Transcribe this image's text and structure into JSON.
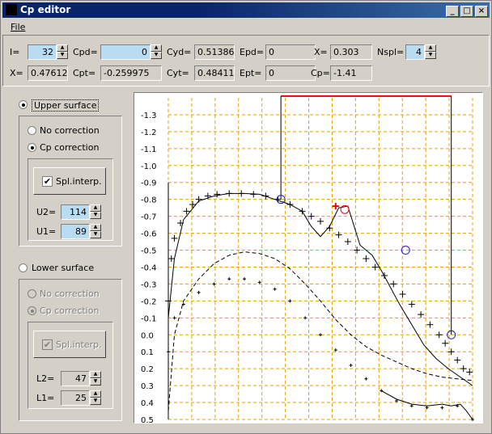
{
  "window": {
    "title": "Cp editor"
  },
  "menu": {
    "file": "File"
  },
  "fields": {
    "i_label": "I=",
    "i_value": "32",
    "cpd_label": "Cpd=",
    "cpd_value": "0",
    "cyd_label": "Cyd=",
    "cyd_value": "0.513863",
    "epd_label": "Epd=",
    "epd_value": "0",
    "x_label": "X=",
    "x_value": "0.303",
    "nspl_label": "Nspl=",
    "nspl_value": "4",
    "x2_label": "X=",
    "x2_value": "0.476129",
    "cpt_label": "Cpt=",
    "cpt_value": "-0.259975",
    "cyt_label": "Cyt=",
    "cyt_value": "0.484114",
    "ept_label": "Ept=",
    "ept_value": "0",
    "cp_label": "Cp=",
    "cp_value": "-1.41"
  },
  "upper": {
    "label": "Upper surface",
    "no_correction": "No correction",
    "cp_correction": "Cp correction",
    "spl_interp": "Spl.interp.",
    "u2_label": "U2=",
    "u2_value": "114",
    "u1_label": "U1=",
    "u1_value": "89"
  },
  "lower": {
    "label": "Lower surface",
    "no_correction": "No correction",
    "cp_correction": "Cp correction",
    "spl_interp": "Spl.interp.",
    "l2_label": "L2=",
    "l2_value": "47",
    "l1_label": "L1=",
    "l1_value": "25"
  },
  "chart_data": {
    "type": "line",
    "y_ticks": [
      "-1.3",
      "-1.2",
      "-1.1",
      "-1.0",
      "-0.9",
      "-0.8",
      "-0.7",
      "-0.6",
      "-0.5",
      "-0.4",
      "-0.3",
      "-0.2",
      "-0.1",
      "0.0",
      "0.1",
      "0.2",
      "0.3",
      "0.4",
      "0.5"
    ],
    "ylim": [
      -1.4,
      0.5
    ],
    "xlim": [
      0,
      1
    ],
    "inverted_y": true,
    "grid": true,
    "series": [
      {
        "style": "plus",
        "color": "#000000",
        "x": [
          0.0,
          0.01,
          0.02,
          0.04,
          0.06,
          0.08,
          0.1,
          0.13,
          0.16,
          0.2,
          0.24,
          0.28,
          0.32,
          0.36,
          0.4,
          0.44,
          0.47,
          0.5,
          0.53,
          0.56,
          0.59,
          0.62,
          0.65,
          0.68,
          0.71,
          0.74,
          0.77,
          0.8,
          0.83,
          0.86,
          0.89,
          0.91,
          0.93,
          0.95,
          0.97,
          0.99
        ],
        "y": [
          -0.2,
          -0.45,
          -0.57,
          -0.66,
          -0.73,
          -0.77,
          -0.8,
          -0.82,
          -0.83,
          -0.835,
          -0.835,
          -0.83,
          -0.82,
          -0.8,
          -0.77,
          -0.73,
          -0.7,
          -0.67,
          -0.63,
          -0.59,
          -0.55,
          -0.5,
          -0.45,
          -0.4,
          -0.35,
          -0.3,
          -0.24,
          -0.18,
          -0.12,
          -0.06,
          0.0,
          0.05,
          0.1,
          0.15,
          0.2,
          0.22
        ]
      },
      {
        "style": "solid",
        "color": "#000000",
        "x": [
          0.0,
          0.02,
          0.05,
          0.1,
          0.15,
          0.2,
          0.25,
          0.3,
          0.35,
          0.4,
          0.44,
          0.47,
          0.5,
          0.53,
          0.56,
          0.59,
          0.63,
          0.67,
          0.7,
          0.73,
          0.76,
          0.8,
          0.84,
          0.88,
          0.92,
          0.96,
          1.0
        ],
        "y": [
          -0.1,
          -0.45,
          -0.68,
          -0.79,
          -0.82,
          -0.835,
          -0.835,
          -0.83,
          -0.8,
          -0.77,
          -0.73,
          -0.64,
          -0.58,
          -0.64,
          -0.75,
          -0.76,
          -0.53,
          -0.47,
          -0.38,
          -0.28,
          -0.18,
          -0.06,
          0.06,
          0.14,
          0.2,
          0.25,
          0.3
        ]
      },
      {
        "style": "dashed",
        "color": "#000000",
        "x": [
          0.0,
          0.02,
          0.05,
          0.1,
          0.15,
          0.2,
          0.25,
          0.3,
          0.35,
          0.4,
          0.45,
          0.5,
          0.55,
          0.6,
          0.65,
          0.7,
          0.75,
          0.8,
          0.85,
          0.9,
          0.95,
          1.0
        ],
        "y": [
          0.45,
          0.0,
          -0.2,
          -0.33,
          -0.42,
          -0.47,
          -0.49,
          -0.48,
          -0.45,
          -0.39,
          -0.3,
          -0.2,
          -0.09,
          0.0,
          0.07,
          0.12,
          0.16,
          0.2,
          0.23,
          0.25,
          0.26,
          0.27
        ]
      },
      {
        "style": "plus-small",
        "color": "#000000",
        "x": [
          0.0,
          0.02,
          0.05,
          0.1,
          0.15,
          0.2,
          0.25,
          0.3,
          0.35,
          0.4,
          0.45,
          0.5,
          0.55,
          0.6,
          0.65,
          0.7,
          0.75,
          0.8,
          0.85,
          0.9,
          0.95,
          1.0
        ],
        "y": [
          0.1,
          -0.1,
          -0.18,
          -0.25,
          -0.3,
          -0.33,
          -0.33,
          -0.31,
          -0.27,
          -0.2,
          -0.1,
          0.0,
          0.09,
          0.18,
          0.26,
          0.33,
          0.39,
          0.42,
          0.43,
          0.43,
          0.42,
          0.5
        ]
      },
      {
        "style": "lower-tail",
        "color": "#000000",
        "x": [
          0.7,
          0.75,
          0.8,
          0.85,
          0.9,
          0.93,
          0.96,
          0.98,
          1.0
        ],
        "y": [
          0.33,
          0.38,
          0.41,
          0.42,
          0.41,
          0.42,
          0.41,
          0.45,
          0.5
        ]
      }
    ],
    "markers": {
      "circles_x": [
        0.37,
        0.78,
        0.93
      ],
      "circles_y": [
        -0.8,
        -0.5,
        0.0
      ],
      "red_plus_x": 0.55,
      "red_plus_y": -0.76,
      "red_circle_x": 0.58,
      "red_circle_y": -0.74
    },
    "range_box": {
      "x_start": 0.37,
      "x_end": 0.93,
      "y_top": -1.41
    }
  }
}
